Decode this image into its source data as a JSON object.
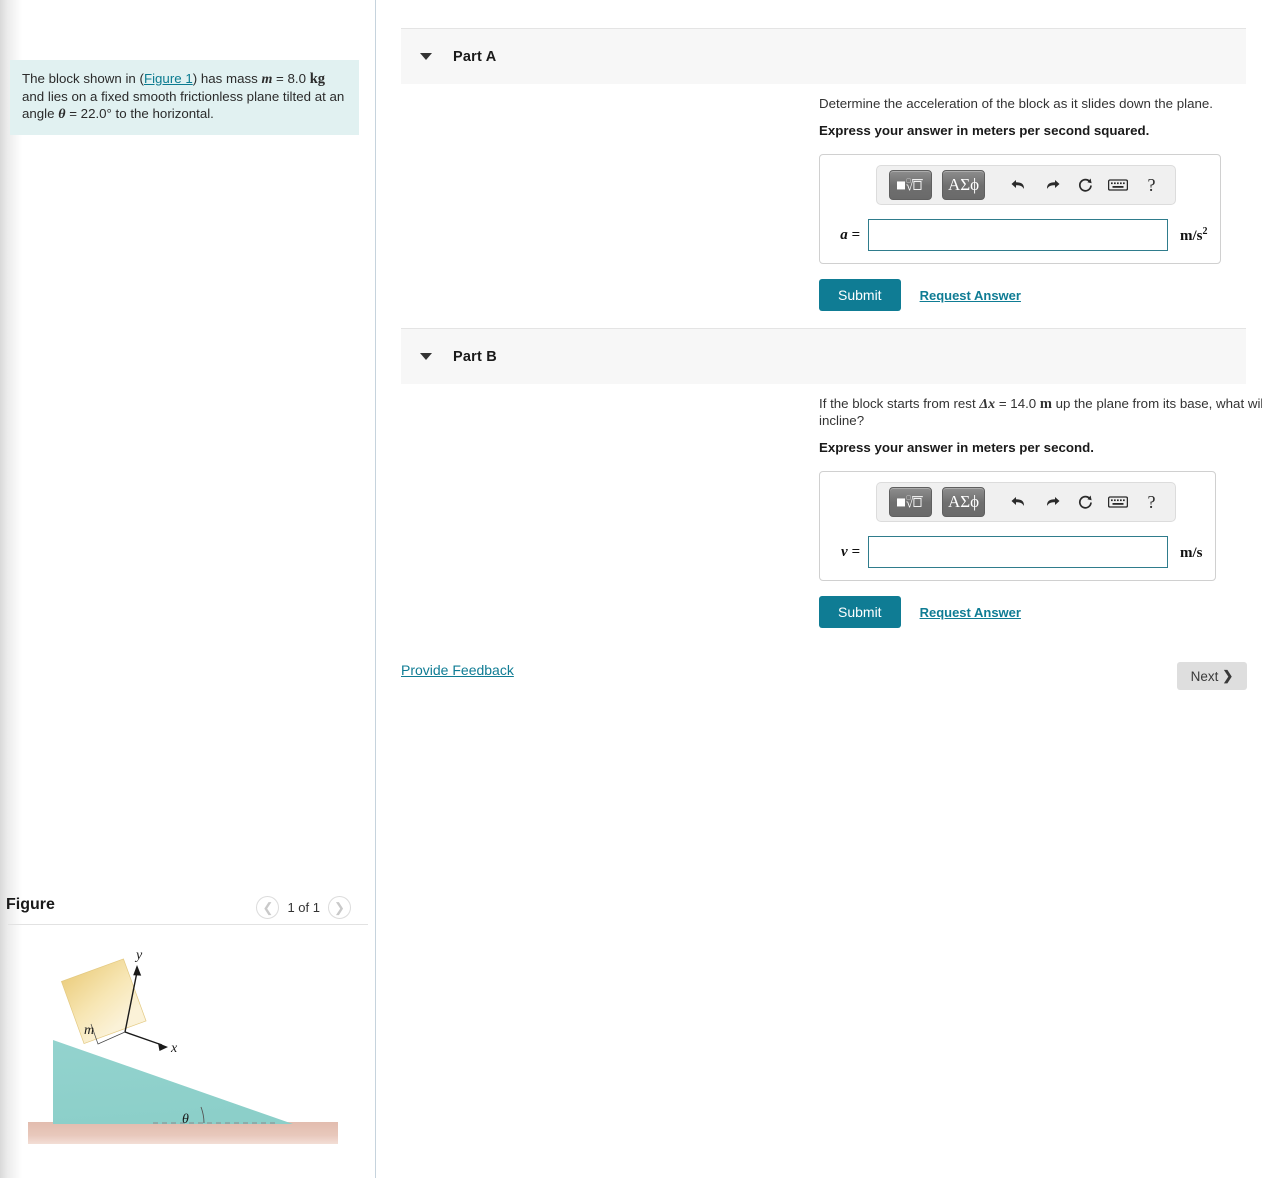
{
  "problem": {
    "text_before_link": "The block shown in (",
    "figure_link": "Figure 1",
    "text_after_link": ") has mass ",
    "mass_symbol": "m",
    "mass_eq": " = 8.0 ",
    "mass_unit": "kg",
    "text_cont": " and lies on a fixed smooth frictionless plane tilted at an angle ",
    "theta_symbol": "θ",
    "theta_value": " = 22.0° to the horizontal."
  },
  "figure": {
    "title": "Figure",
    "counter": "1 of 1",
    "prev_icon": "chevron-left-icon",
    "next_icon": "chevron-right-icon",
    "labels": {
      "y_axis": "y",
      "x_axis": "x",
      "mass": "m",
      "angle": "θ"
    },
    "colors": {
      "incline": "#8ed2cd",
      "block_light": "#faecc0",
      "block_dark": "#eac97a",
      "ground": "#e8c7bb"
    }
  },
  "parts": [
    {
      "id": "part-a",
      "label": "Part A",
      "caret_icon": "caret-down-icon",
      "question": "Determine the acceleration of the block as it slides down the plane.",
      "instruction": "Express your answer in meters per second squared.",
      "toolbar": {
        "template_button": "√",
        "template_name": "math-template-button",
        "greek_button": "ΑΣϕ",
        "undo_icon": "undo-arrow-icon",
        "redo_icon": "redo-arrow-icon",
        "reset_icon": "reset-circle-icon",
        "keyboard_icon": "keyboard-icon",
        "help_icon": "?"
      },
      "answer": {
        "variable": "a =",
        "value": "",
        "placeholder": "",
        "unit_base": "m/s",
        "unit_sup": "2"
      },
      "submit_label": "Submit",
      "request_answer_label": "Request Answer"
    },
    {
      "id": "part-b",
      "label": "Part B",
      "caret_icon": "caret-down-icon",
      "question_pre": "If the block starts from rest ",
      "question_delta": "Δx",
      "question_mid": " = 14.0 ",
      "question_unit": "m",
      "question_post": " up the plane from its base, what will be the block's speed when it reaches the bottom of the incline?",
      "instruction": "Express your answer in meters per second.",
      "toolbar": {
        "template_button": "√",
        "template_name": "math-template-button",
        "greek_button": "ΑΣϕ",
        "undo_icon": "undo-arrow-icon",
        "redo_icon": "redo-arrow-icon",
        "reset_icon": "reset-circle-icon",
        "keyboard_icon": "keyboard-icon",
        "help_icon": "?"
      },
      "answer": {
        "variable": "v =",
        "value": "",
        "placeholder": "",
        "unit_base": "m/s",
        "unit_sup": ""
      },
      "submit_label": "Submit",
      "request_answer_label": "Request Answer"
    }
  ],
  "footer": {
    "feedback_label": "Provide Feedback",
    "next_label": "Next",
    "next_chevron": "❯"
  },
  "colors": {
    "accent": "#0f7c94",
    "link": "#0b7b90",
    "problem_bg": "#e1f1f1",
    "header_bg": "#f7f7f7",
    "input_border": "#2f7c8c"
  }
}
